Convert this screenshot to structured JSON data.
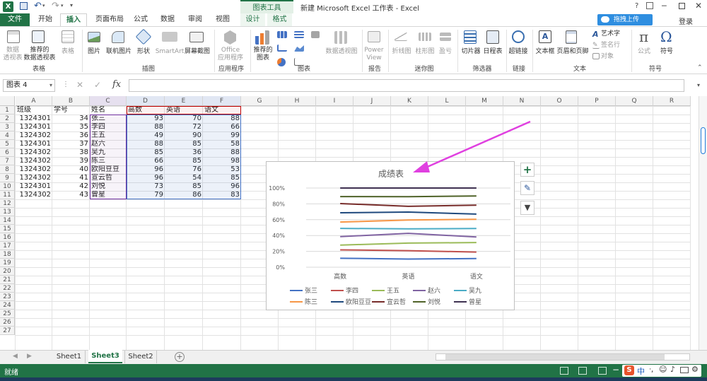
{
  "window": {
    "title": "新建 Microsoft Excel 工作表 - Excel",
    "context_tools": "图表工具",
    "help": "?",
    "signin": "登录",
    "upload_btn": "拖拽上传"
  },
  "tabs": [
    "文件",
    "开始",
    "插入",
    "页面布局",
    "公式",
    "数据",
    "审阅",
    "视图",
    "设计",
    "格式"
  ],
  "ribbon": {
    "groups": [
      "表格",
      "插图",
      "应用程序",
      "图表",
      "报告",
      "迷你图",
      "筛选器",
      "链接",
      "文本",
      "符号"
    ],
    "buttons": {
      "pivot": "数据\n透视表",
      "rec_pivot": "推荐的\n数据透视表",
      "table": "表格",
      "pictures": "图片",
      "online_pictures": "联机图片",
      "shapes": "形状",
      "smartart": "SmartArt",
      "screenshot": "屏幕截图",
      "office_apps": "Office\n应用程序",
      "rec_charts": "推荐的\n图表",
      "pivotchart": "数据透视图",
      "powerview": "Power\nView",
      "line": "折线图",
      "column": "柱形图",
      "winloss": "盈亏",
      "slicer": "切片器",
      "timeline": "日程表",
      "hyperlink": "超链接",
      "textbox": "文本框",
      "header_footer": "页眉和页脚",
      "wordart": "艺术字",
      "signature": "签名行",
      "object": "对象",
      "equation": "公式",
      "symbol": "符号"
    }
  },
  "formula": {
    "namebox": "图表 4",
    "cancel": "✕",
    "enter": "✓",
    "fx": "fx",
    "content": ""
  },
  "columns": [
    "A",
    "B",
    "C",
    "D",
    "E",
    "F",
    "G",
    "H",
    "I",
    "J",
    "K",
    "L",
    "M",
    "N",
    "O",
    "P",
    "Q",
    "R"
  ],
  "rows": [
    "1",
    "2",
    "3",
    "4",
    "5",
    "6",
    "7",
    "8",
    "9",
    "10",
    "11",
    "12",
    "13",
    "14",
    "15",
    "16",
    "17",
    "18",
    "19",
    "20",
    "21",
    "22",
    "23",
    "24",
    "25",
    "26",
    "27"
  ],
  "table": {
    "header": [
      "班级",
      "学号",
      "姓名",
      "高数",
      "英语",
      "语文"
    ],
    "body": [
      [
        "1324301",
        "34",
        "张三",
        "93",
        "70",
        "88"
      ],
      [
        "1324301",
        "35",
        "李四",
        "88",
        "72",
        "66"
      ],
      [
        "1324302",
        "36",
        "王五",
        "49",
        "90",
        "99"
      ],
      [
        "1324301",
        "37",
        "赵六",
        "88",
        "85",
        "58"
      ],
      [
        "1324302",
        "38",
        "吴九",
        "85",
        "36",
        "88"
      ],
      [
        "1324302",
        "39",
        "陈三",
        "66",
        "85",
        "98"
      ],
      [
        "1324302",
        "40",
        "欧阳豆豆",
        "96",
        "76",
        "53"
      ],
      [
        "1324302",
        "41",
        "宣云哲",
        "96",
        "54",
        "85"
      ],
      [
        "1324301",
        "42",
        "刘悦",
        "73",
        "85",
        "96"
      ],
      [
        "1324302",
        "43",
        "曾星",
        "79",
        "86",
        "83"
      ]
    ]
  },
  "chart_data": {
    "type": "line",
    "title": "成绩表",
    "stacked_percent": true,
    "categories": [
      "高数",
      "英语",
      "语文"
    ],
    "ylim": [
      0,
      1
    ],
    "yticks": [
      "0%",
      "20%",
      "40%",
      "60%",
      "80%",
      "100%"
    ],
    "legend_position": "bottom",
    "series": [
      {
        "name": "张三",
        "color": "#4472C4",
        "values": [
          0.113,
          0.103,
          0.109
        ]
      },
      {
        "name": "李四",
        "color": "#C0504D",
        "values": [
          0.219,
          0.209,
          0.191
        ]
      },
      {
        "name": "王五",
        "color": "#9BBB59",
        "values": [
          0.279,
          0.305,
          0.311
        ]
      },
      {
        "name": "赵六",
        "color": "#8064A2",
        "values": [
          0.386,
          0.428,
          0.382
        ]
      },
      {
        "name": "吴九",
        "color": "#4BACC6",
        "values": [
          0.49,
          0.484,
          0.489
        ]
      },
      {
        "name": "陈三",
        "color": "#F79646",
        "values": [
          0.57,
          0.596,
          0.605
        ]
      },
      {
        "name": "欧阳豆豆",
        "color": "#1F497D",
        "values": [
          0.687,
          0.696,
          0.671
        ]
      },
      {
        "name": "宣云哲",
        "color": "#772C2A",
        "values": [
          0.804,
          0.769,
          0.784
        ]
      },
      {
        "name": "刘悦",
        "color": "#4F6228",
        "values": [
          0.892,
          0.891,
          0.899
        ]
      },
      {
        "name": "曾星",
        "color": "#3F3151",
        "values": [
          1.0,
          1.0,
          1.0
        ]
      }
    ]
  },
  "chart_side_buttons": [
    "+",
    "✎",
    "▼"
  ],
  "sheets": [
    "Sheet1",
    "Sheet3",
    "Sheet2"
  ],
  "active_sheet": "Sheet3",
  "status": {
    "ready": "就绪",
    "ime": "中"
  },
  "colors": {
    "accent": "#217346",
    "selection_purple": "#7030A0",
    "selection_red": "#C00000",
    "selection_blue": "#4472C4",
    "annotation_arrow": "#E040E0"
  }
}
